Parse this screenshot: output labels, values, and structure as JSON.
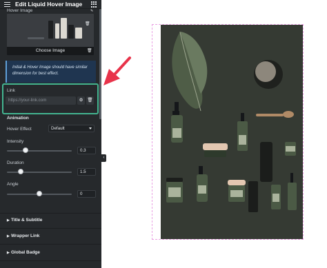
{
  "header": {
    "title": "Edit Liquid Hover Image"
  },
  "hover_image": {
    "label": "Hover Image",
    "choose_label": "Choose Image"
  },
  "notice": {
    "text": "Initial & Hover Image should have similar dimension for best effect."
  },
  "link": {
    "label": "Link",
    "placeholder": "https://your-link.com"
  },
  "animation": {
    "section_label": "Animation",
    "hover_effect_label": "Hover Effect",
    "hover_effect_value": "Default",
    "intensity_label": "Intensity",
    "intensity_value": "0.3",
    "duration_label": "Duration",
    "duration_value": "1.5",
    "angle_label": "Angle",
    "angle_value": "0"
  },
  "accordions": {
    "title_subtitle": "Title & Subtitle",
    "wrapper_link": "Wrapper Link",
    "global_badge": "Global Badge"
  },
  "colors": {
    "panel_bg": "#26292c",
    "highlight_border": "#43b591",
    "arrow": "#e8334a",
    "notice_bg": "#1f3550",
    "preview_border": "#e9a0e3",
    "photo_bg": "#333831"
  },
  "icons": {
    "menu": "hamburger-icon",
    "apps": "grid-icon",
    "settings": "gear-icon",
    "delete": "trash-icon",
    "collapse": "chevron-left-icon"
  }
}
